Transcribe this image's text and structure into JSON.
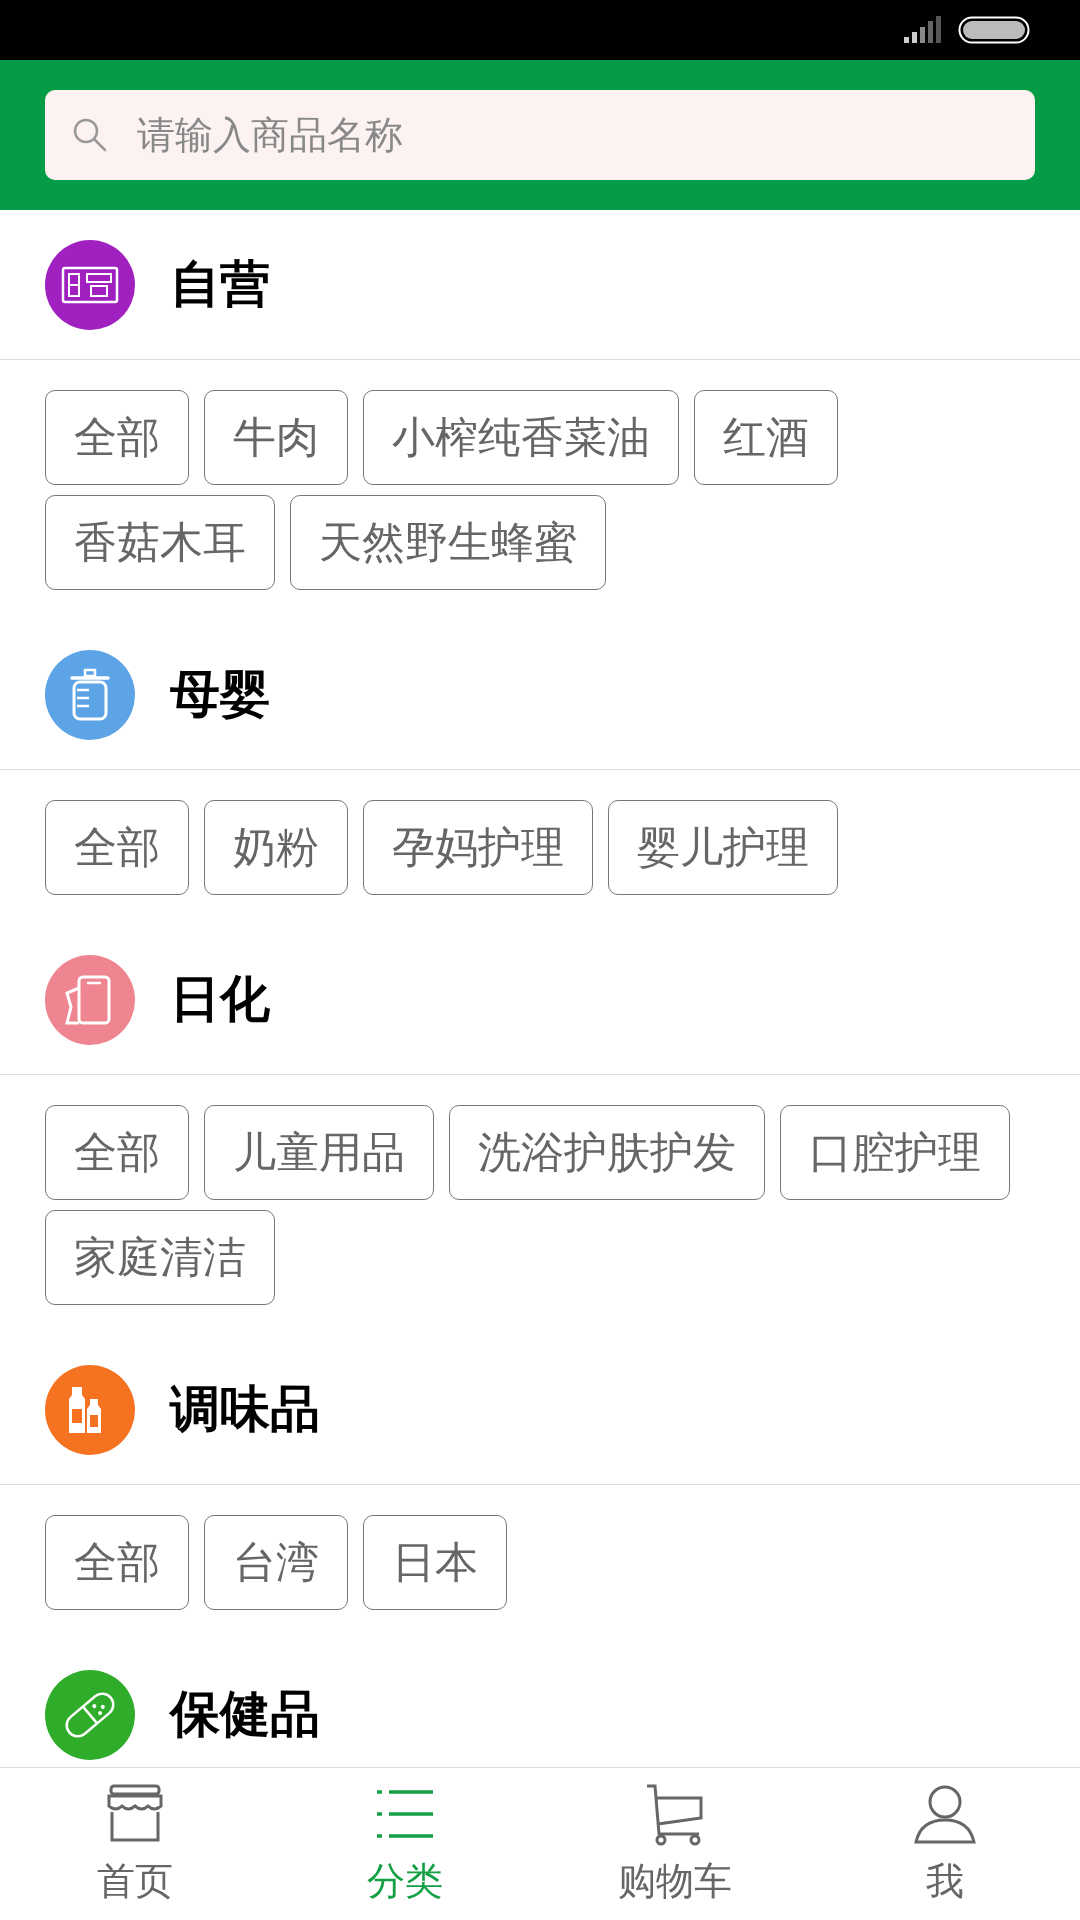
{
  "search": {
    "placeholder": "请输入商品名称"
  },
  "categories": [
    {
      "name": "自营",
      "kind": "store",
      "color": "#a020c0",
      "tags": [
        "全部",
        "牛肉",
        "小榨纯香菜油",
        "红酒",
        "香菇木耳",
        "天然野生蜂蜜"
      ]
    },
    {
      "name": "母婴",
      "kind": "bottle",
      "color": "#5ca4e6",
      "tags": [
        "全部",
        "奶粉",
        "孕妈护理",
        "婴儿护理"
      ]
    },
    {
      "name": "日化",
      "kind": "tissue",
      "color": "#ee8590",
      "tags": [
        "全部",
        "儿童用品",
        "洗浴护肤护发",
        "口腔护理",
        "家庭清洁"
      ]
    },
    {
      "name": "调味品",
      "kind": "sauce",
      "color": "#f57320",
      "tags": [
        "全部",
        "台湾",
        "日本"
      ]
    },
    {
      "name": "保健品",
      "kind": "pill",
      "color": "#2eac2a"
    }
  ],
  "nav": [
    {
      "label": "首页",
      "kind": "shop",
      "selected": false
    },
    {
      "label": "分类",
      "kind": "list",
      "selected": true
    },
    {
      "label": "购物车",
      "kind": "cart",
      "selected": false
    },
    {
      "label": "我",
      "kind": "user",
      "selected": false
    }
  ]
}
